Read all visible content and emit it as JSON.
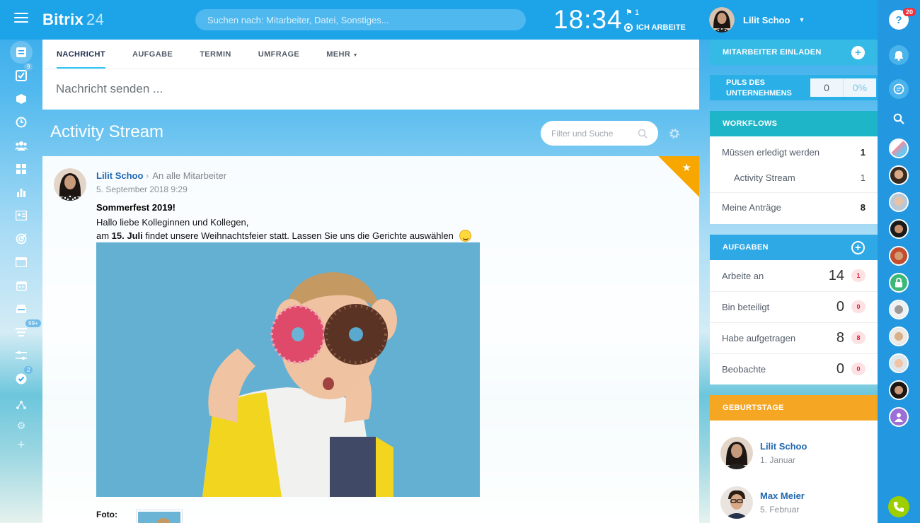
{
  "header": {
    "logo_main": "Bitrix",
    "logo_num": "24",
    "search_placeholder": "Suchen nach: Mitarbeiter, Datei, Sonstiges...",
    "clock": "18:34",
    "flag_count": "1",
    "work_status": "ICH ARBEITE",
    "user_name": "Lilit Schoo"
  },
  "left_rail": {
    "badges": {
      "tasks": "9",
      "stream": "99+",
      "check": "2"
    }
  },
  "composer": {
    "tabs": [
      "NACHRICHT",
      "AUFGABE",
      "TERMIN",
      "UMFRAGE",
      "MEHR"
    ],
    "placeholder": "Nachricht senden ..."
  },
  "stream": {
    "title": "Activity Stream",
    "filter_placeholder": "Filter und Suche"
  },
  "post": {
    "author": "Lilit Schoo",
    "recipient": "An alle Mitarbeiter",
    "date": "5. September 2018 9:29",
    "title": "Sommerfest 2019!",
    "line1": "Hallo liebe Kolleginnen und Kollegen,",
    "line2_pre": "am ",
    "line2_bold": "15. Juli",
    "line2_post": " findet unsere Weihnachtsfeier statt. Lassen Sie uns die Gerichte auswählen",
    "foto_label": "Foto:"
  },
  "right": {
    "invite": "MITARBEITER EINLADEN",
    "puls_label_1": "PULS DES",
    "puls_label_2": "UNTERNEHMENS",
    "puls_value": "0",
    "puls_percent": "0%",
    "workflows": {
      "title": "WORKFLOWS",
      "rows": [
        {
          "label": "Müssen erledigt werden",
          "value": "1"
        },
        {
          "label": "Activity Stream",
          "value": "1"
        },
        {
          "label": "Meine Anträge",
          "value": "8"
        }
      ]
    },
    "tasks": {
      "title": "AUFGABEN",
      "rows": [
        {
          "label": "Arbeite an",
          "value": "14",
          "badge": "1"
        },
        {
          "label": "Bin beteiligt",
          "value": "0",
          "badge": "0"
        },
        {
          "label": "Habe aufgetragen",
          "value": "8",
          "badge": "8"
        },
        {
          "label": "Beobachte",
          "value": "0",
          "badge": "0"
        }
      ]
    },
    "birthdays": {
      "title": "GEBURTSTAGE",
      "people": [
        {
          "name": "Lilit Schoo",
          "date": "1. Januar"
        },
        {
          "name": "Max Meier",
          "date": "5. Februar"
        }
      ]
    }
  },
  "right_rail": {
    "help_badge": "20"
  },
  "colors": {
    "header": "#1da3e8",
    "accent_tab": "#2fc6f6",
    "link": "#2067b0",
    "workflows": "#1fb5c8",
    "tasks": "#2fa9e6",
    "birthdays": "#f5a623",
    "badge_red": "#e21b45"
  }
}
